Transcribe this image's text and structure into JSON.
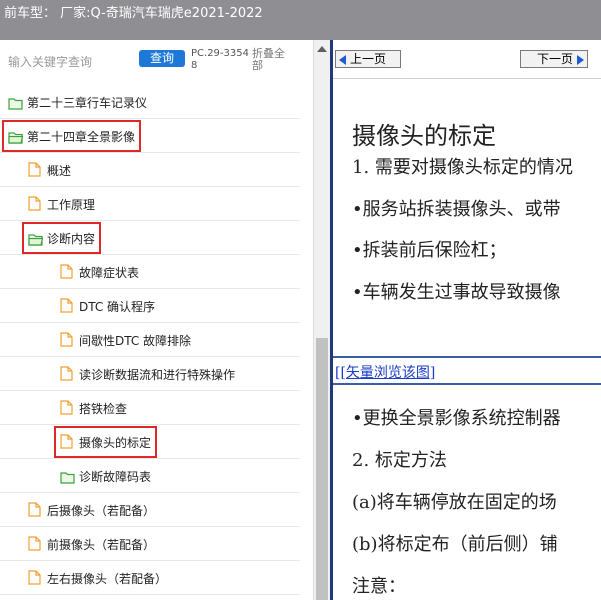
{
  "header": {
    "title": "前车型： 厂家:Q-奇瑞汽车瑞虎e2021-2022"
  },
  "sidebar": {
    "search_placeholder": "输入关键字查询",
    "query_button": "查询",
    "pc_code": "PC.29-33548",
    "fold_all": "折叠全部",
    "items": [
      {
        "label": "第二十三章行车记录仪",
        "icon": "folder-icon",
        "level": 0,
        "highlighted": false
      },
      {
        "label": "第二十四章全景影像",
        "icon": "folder-open-icon",
        "level": 0,
        "highlighted": true
      },
      {
        "label": "概述",
        "icon": "document-icon",
        "level": 1,
        "highlighted": false
      },
      {
        "label": "工作原理",
        "icon": "document-icon",
        "level": 1,
        "highlighted": false
      },
      {
        "label": "诊断内容",
        "icon": "folder-open-icon",
        "level": 1,
        "highlighted": true
      },
      {
        "label": "故障症状表",
        "icon": "document-icon",
        "level": 2,
        "highlighted": false
      },
      {
        "label": "DTC 确认程序",
        "icon": "document-icon",
        "level": 2,
        "highlighted": false
      },
      {
        "label": "间歇性DTC 故障排除",
        "icon": "document-icon",
        "level": 2,
        "highlighted": false
      },
      {
        "label": "读诊断数据流和进行特殊操作",
        "icon": "document-icon",
        "level": 2,
        "highlighted": false
      },
      {
        "label": "搭铁检查",
        "icon": "document-icon",
        "level": 2,
        "highlighted": false
      },
      {
        "label": "摄像头的标定",
        "icon": "document-icon",
        "level": 2,
        "highlighted": true
      },
      {
        "label": "诊断故障码表",
        "icon": "folder-icon",
        "level": 2,
        "highlighted": false
      },
      {
        "label": "后摄像头（若配备）",
        "icon": "document-icon",
        "level": 1,
        "highlighted": false
      },
      {
        "label": "前摄像头（若配备）",
        "icon": "document-icon",
        "level": 1,
        "highlighted": false
      },
      {
        "label": "左右摄像头（若配备）",
        "icon": "document-icon",
        "level": 1,
        "highlighted": false
      }
    ]
  },
  "content": {
    "prev_button": "上一页",
    "next_button": "下一页",
    "title": "摄像头的标定",
    "lines_top": [
      "1. 需要对摄像头标定的情况",
      "•服务站拆装摄像头、或带",
      "•拆装前后保险杠；",
      "•车辆发生过事故导致摄像"
    ],
    "vector_link": "[[矢量浏览该图]",
    "lines_bottom": [
      "•更换全景影像系统控制器",
      "2. 标定方法",
      "(a)将车辆停放在固定的场",
      "(b)将标定布（前后侧）铺",
      "注意："
    ]
  },
  "colors": {
    "header_bg": "#8f8f93",
    "query_button_bg": "#1e78d7",
    "highlight_border": "#e02828",
    "folder_green": "#3aa33a",
    "document_orange": "#f0a030",
    "link_blue": "#1a3cc7"
  }
}
